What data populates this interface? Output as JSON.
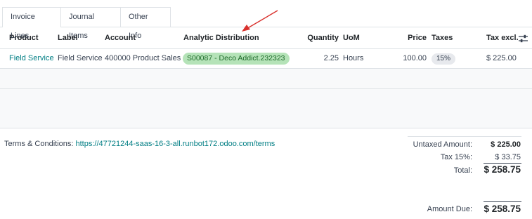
{
  "tabs": [
    {
      "label": "Invoice Lines",
      "active": true
    },
    {
      "label": "Journal Items",
      "active": false
    },
    {
      "label": "Other Info",
      "active": false
    }
  ],
  "table": {
    "headers": {
      "product": "Product",
      "label": "Label",
      "account": "Account",
      "analytic": "Analytic Distribution",
      "quantity": "Quantity",
      "uom": "UoM",
      "price": "Price",
      "taxes": "Taxes",
      "tax_excl": "Tax excl."
    },
    "rows": [
      {
        "product": "Field Service",
        "label": "Field Service",
        "account": "400000 Product Sales",
        "analytic": "S00087 - Deco Addict.232323",
        "quantity": "2.25",
        "uom": "Hours",
        "price": "100.00",
        "taxes": "15%",
        "tax_excl": "$ 225.00"
      }
    ]
  },
  "icons": {
    "column_settings": "sliders-icon",
    "annotation": "red-arrow-icon"
  },
  "colors": {
    "link": "#017e84",
    "analytic_badge": "#b5e3b8",
    "arrow": "#d9302c"
  },
  "terms": {
    "label": "Terms & Conditions: ",
    "url": "https://47721244-saas-16-3-all.runbot172.odoo.com/terms"
  },
  "totals": {
    "untaxed_label": "Untaxed Amount:",
    "untaxed_value": "$ 225.00",
    "tax_label": "Tax 15%:",
    "tax_value": "$ 33.75",
    "total_label": "Total:",
    "total_value": "$ 258.75",
    "due_label": "Amount Due:",
    "due_value": "$ 258.75"
  }
}
